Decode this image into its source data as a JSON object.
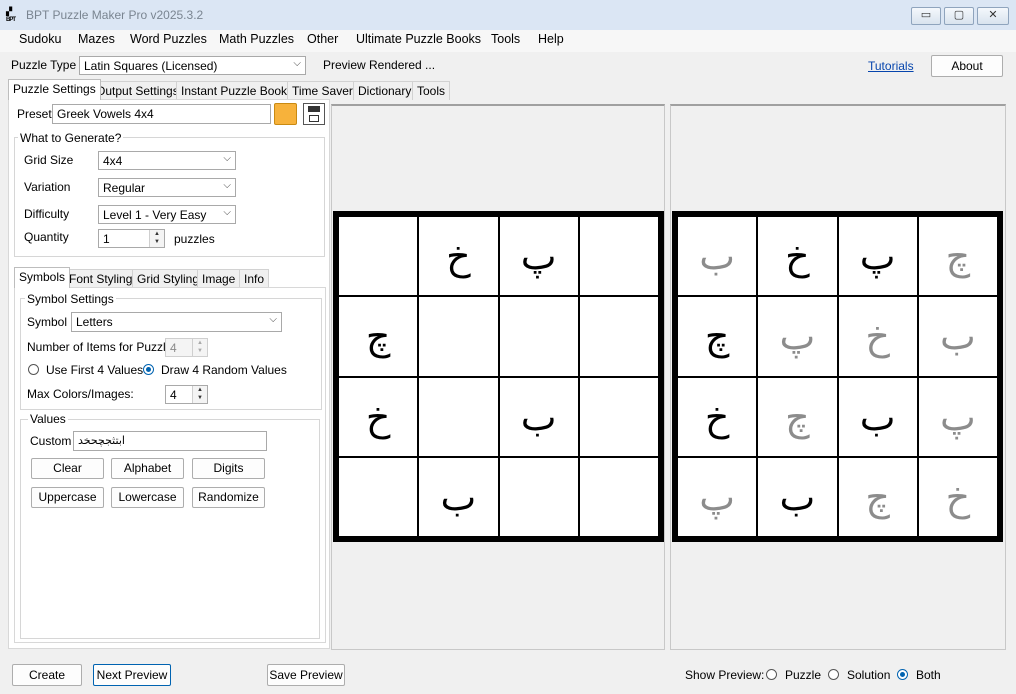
{
  "window": {
    "title": "BPT Puzzle Maker Pro v2025.3.2",
    "icon_text": "BPT"
  },
  "window_controls": {
    "minimize": "▭",
    "restore": "▢",
    "close": "✕"
  },
  "menu": [
    "Sudoku",
    "Mazes",
    "Word Puzzles",
    "Math Puzzles",
    "Other",
    "Ultimate Puzzle Books",
    "Tools",
    "Help"
  ],
  "toolbar": {
    "puzzle_type_label": "Puzzle Type",
    "puzzle_type_value": "Latin Squares (Licensed)",
    "status": "Preview Rendered ...",
    "tutorials": "Tutorials",
    "about": "About"
  },
  "main_tabs": [
    "Puzzle Settings",
    "Output Settings",
    "Instant Puzzle Books",
    "Time Saver",
    "Dictionary",
    "Tools"
  ],
  "preset": {
    "label": "Preset",
    "value": "Greek Vowels 4x4"
  },
  "generate": {
    "group_title": "What to Generate?",
    "grid_size_label": "Grid Size",
    "grid_size_value": "4x4",
    "variation_label": "Variation",
    "variation_value": "Regular",
    "difficulty_label": "Difficulty",
    "difficulty_value": "Level 1 - Very Easy",
    "quantity_label": "Quantity",
    "quantity_value": "1",
    "quantity_unit": "puzzles"
  },
  "sub_tabs": [
    "Symbols",
    "Font Styling",
    "Grid Styling",
    "Image",
    "Info"
  ],
  "symbols": {
    "group_title": "Symbol Settings",
    "symbol_label": "Symbol",
    "symbol_value": "Letters",
    "items_label": "Number of Items for Puzzle:",
    "items_value": "4",
    "radio_first": "Use First 4 Values",
    "radio_random": "Draw 4 Random Values",
    "max_colors_label": "Max Colors/Images:",
    "max_colors_value": "4"
  },
  "values": {
    "group_title": "Values",
    "custom_label": "Custom",
    "custom_value": "ابتثجچحخد",
    "buttons": [
      "Clear",
      "Alphabet",
      "Digits",
      "Uppercase",
      "Lowercase",
      "Randomize"
    ]
  },
  "puzzle_grid": [
    [
      "",
      "خ",
      "پ",
      ""
    ],
    [
      "چ",
      "",
      "",
      ""
    ],
    [
      "خ",
      "",
      "ب",
      ""
    ],
    [
      "",
      "ب",
      "",
      ""
    ]
  ],
  "solution_grid": [
    [
      "ب",
      "خ",
      "پ",
      "چ"
    ],
    [
      "چ",
      "پ",
      "خ",
      "ب"
    ],
    [
      "خ",
      "چ",
      "ب",
      "پ"
    ],
    [
      "پ",
      "ب",
      "چ",
      "خ"
    ]
  ],
  "solution_given_mask": [
    [
      false,
      true,
      true,
      false
    ],
    [
      true,
      false,
      false,
      false
    ],
    [
      true,
      false,
      true,
      false
    ],
    [
      false,
      true,
      false,
      false
    ]
  ],
  "bottom": {
    "create": "Create",
    "next_preview": "Next Preview",
    "save_preview": "Save Preview",
    "show_preview_label": "Show Preview:",
    "options": [
      "Puzzle",
      "Solution",
      "Both"
    ],
    "selected": "Both"
  },
  "colors": {
    "accent": "#0063b1",
    "given": "#000000",
    "solved": "#8c8c8c"
  }
}
